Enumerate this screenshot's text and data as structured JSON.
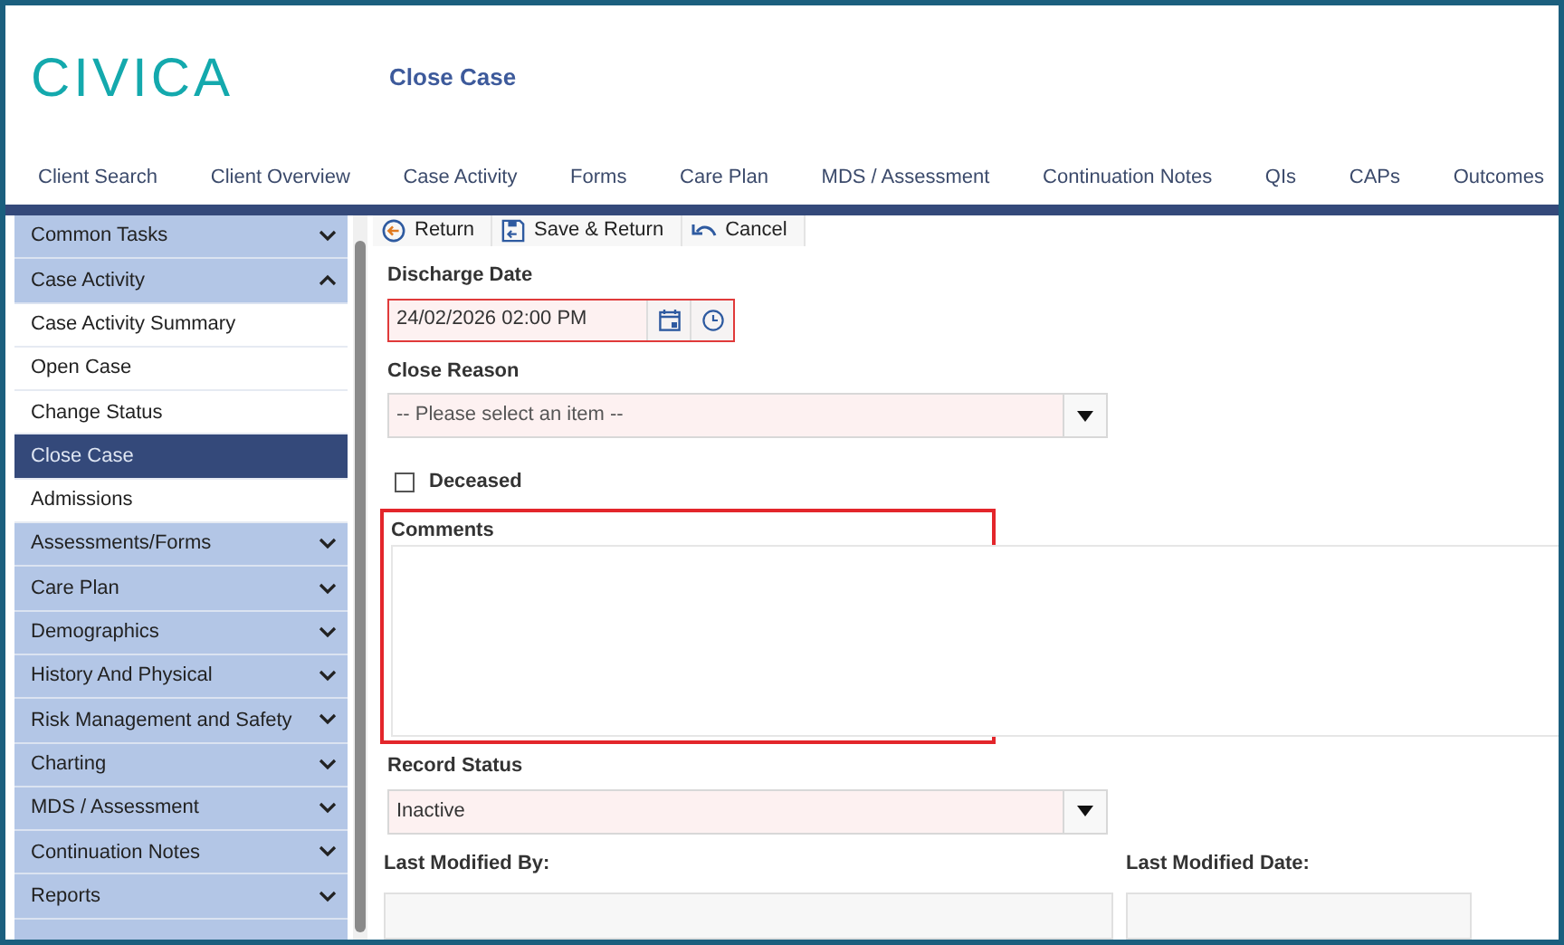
{
  "logo": "CIVICA",
  "page_title": "Close Case",
  "nav_tabs": [
    {
      "label": "Client Search"
    },
    {
      "label": "Client Overview"
    },
    {
      "label": "Case Activity"
    },
    {
      "label": "Forms"
    },
    {
      "label": "Care Plan"
    },
    {
      "label": "MDS / Assessment"
    },
    {
      "label": "Continuation Notes"
    },
    {
      "label": "QIs"
    },
    {
      "label": "CAPs"
    },
    {
      "label": "Outcomes"
    }
  ],
  "sidebar": {
    "items": [
      {
        "label": "Common Tasks",
        "kind": "group",
        "expanded": false
      },
      {
        "label": "Case Activity",
        "kind": "group",
        "expanded": true
      },
      {
        "label": "Case Activity Summary",
        "kind": "link",
        "selected": false
      },
      {
        "label": "Open Case",
        "kind": "link",
        "selected": false
      },
      {
        "label": "Change Status",
        "kind": "link",
        "selected": false
      },
      {
        "label": "Close Case",
        "kind": "link",
        "selected": true
      },
      {
        "label": "Admissions",
        "kind": "link",
        "selected": false
      },
      {
        "label": "Assessments/Forms",
        "kind": "group",
        "expanded": false
      },
      {
        "label": "Care Plan",
        "kind": "group",
        "expanded": false
      },
      {
        "label": "Demographics",
        "kind": "group",
        "expanded": false
      },
      {
        "label": "History And Physical",
        "kind": "group",
        "expanded": false
      },
      {
        "label": "Risk Management and Safety",
        "kind": "group",
        "expanded": false
      },
      {
        "label": "Charting",
        "kind": "group",
        "expanded": false
      },
      {
        "label": "MDS / Assessment",
        "kind": "group",
        "expanded": false
      },
      {
        "label": "Continuation Notes",
        "kind": "group",
        "expanded": false
      },
      {
        "label": "Reports",
        "kind": "group",
        "expanded": false
      }
    ]
  },
  "toolbar": [
    {
      "label": "Return",
      "kind": "return"
    },
    {
      "label": "Save & Return",
      "kind": "save"
    },
    {
      "label": "Cancel",
      "kind": "cancel"
    }
  ],
  "form": {
    "discharge_date": {
      "label": "Discharge Date",
      "value": "24/02/2026 02:00 PM",
      "invalid": true
    },
    "close_reason": {
      "label": "Close Reason",
      "placeholder": "-- Please select an item --"
    },
    "deceased": {
      "label": "Deceased",
      "checked": false
    },
    "comments": {
      "label": "Comments",
      "highlighted": true
    },
    "record_status": {
      "label": "Record Status",
      "value": "Inactive"
    },
    "last_modified_by": {
      "label": "Last Modified By:"
    },
    "last_modified_date": {
      "label": "Last Modified Date:"
    }
  }
}
